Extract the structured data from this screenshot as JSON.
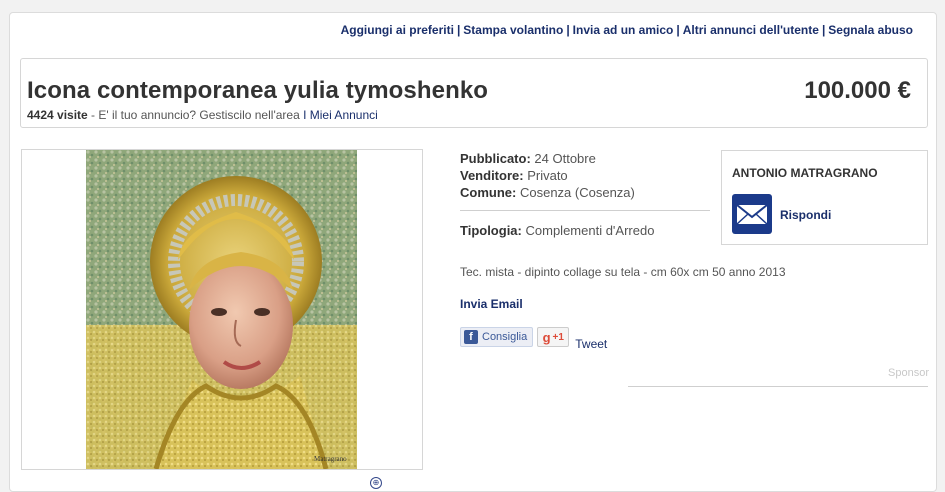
{
  "top_links": {
    "favorites": "Aggiungi ai preferiti",
    "print_flyer": "Stampa volantino",
    "send_friend": "Invia ad un amico",
    "other_ads": "Altri annunci dell'utente",
    "report_abuse": "Segnala abuso",
    "separator": "|"
  },
  "listing": {
    "title": "Icona contemporanea yulia tymoshenko",
    "price": "100.000 €",
    "visits_count": "4424 visite",
    "visits_text": " - E' il tuo annuncio? Gestiscilo nell'area ",
    "my_ads_link": "I Miei Annunci"
  },
  "image": {
    "signature": "Matragrano",
    "zoom_icon": "zoom-icon"
  },
  "details": {
    "published_label": "Pubblicato:",
    "published_value": "24 Ottobre",
    "seller_label": "Venditore:",
    "seller_value": "Privato",
    "town_label": "Comune:",
    "town_value": "Cosenza (Cosenza)",
    "type_label": "Tipologia:",
    "type_value": "Complementi d'Arredo",
    "description": "Tec. mista - dipinto collage su tela - cm 60x cm 50 anno 2013",
    "send_email": "Invia Email"
  },
  "social": {
    "fb_like": "Consiglia",
    "gplus": "+1",
    "tweet": "Tweet"
  },
  "contact": {
    "name": "ANTONIO MATRAGRANO",
    "reply": "Rispondi"
  },
  "sponsor": "Sponsor",
  "colors": {
    "link": "#1a2f6b",
    "mail_icon_bg": "#1b3a8a",
    "fb_blue": "#3b5998",
    "gplus_red": "#dd4b39"
  }
}
